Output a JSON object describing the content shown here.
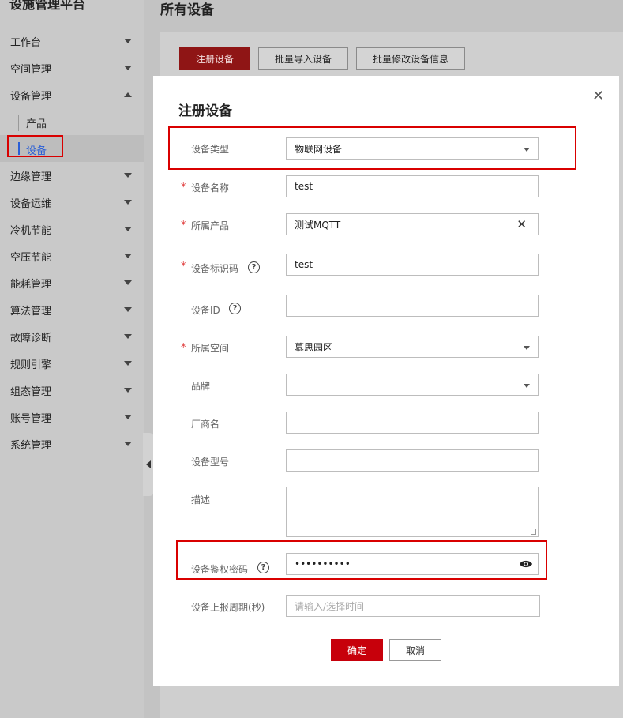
{
  "sidebar": {
    "platform_title": "设施管理平台",
    "items": [
      {
        "label": "工作台",
        "expanded": false
      },
      {
        "label": "空间管理",
        "expanded": false
      },
      {
        "label": "设备管理",
        "expanded": true
      },
      {
        "label": "边缘管理",
        "expanded": false
      },
      {
        "label": "设备运维",
        "expanded": false
      },
      {
        "label": "冷机节能",
        "expanded": false
      },
      {
        "label": "空压节能",
        "expanded": false
      },
      {
        "label": "能耗管理",
        "expanded": false
      },
      {
        "label": "算法管理",
        "expanded": false
      },
      {
        "label": "故障诊断",
        "expanded": false
      },
      {
        "label": "规则引擎",
        "expanded": false
      },
      {
        "label": "组态管理",
        "expanded": false
      },
      {
        "label": "账号管理",
        "expanded": false
      },
      {
        "label": "系统管理",
        "expanded": false
      }
    ],
    "sub_items": [
      {
        "label": "产品",
        "active": false
      },
      {
        "label": "设备",
        "active": true
      }
    ]
  },
  "main": {
    "page_title": "所有设备",
    "toolbar": {
      "register": "注册设备",
      "batch_import": "批量导入设备",
      "batch_edit": "批量修改设备信息"
    }
  },
  "dialog": {
    "title": "注册设备",
    "fields": {
      "device_type": {
        "label": "设备类型",
        "value": "物联网设备"
      },
      "device_name": {
        "label": "设备名称",
        "value": "test"
      },
      "product": {
        "label": "所属产品",
        "value": "测试MQTT"
      },
      "device_identifier": {
        "label": "设备标识码",
        "value": "test"
      },
      "device_id": {
        "label": "设备ID",
        "value": ""
      },
      "space": {
        "label": "所属空间",
        "value": "慕思园区"
      },
      "brand": {
        "label": "品牌",
        "value": ""
      },
      "manufacturer": {
        "label": "厂商名",
        "value": ""
      },
      "model": {
        "label": "设备型号",
        "value": ""
      },
      "description": {
        "label": "描述",
        "value": ""
      },
      "auth_password": {
        "label": "设备鉴权密码",
        "value": "••••••••••"
      },
      "report_period": {
        "label": "设备上报周期(秒)",
        "placeholder": "请输入/选择时间"
      }
    },
    "required_mark": "*",
    "help_glyph": "?",
    "close_glyph": "✕",
    "confirm": "确定",
    "cancel": "取消"
  },
  "colors": {
    "primary": "#c7000b",
    "highlight": "#d90000",
    "active_link": "#2a5fd6"
  }
}
